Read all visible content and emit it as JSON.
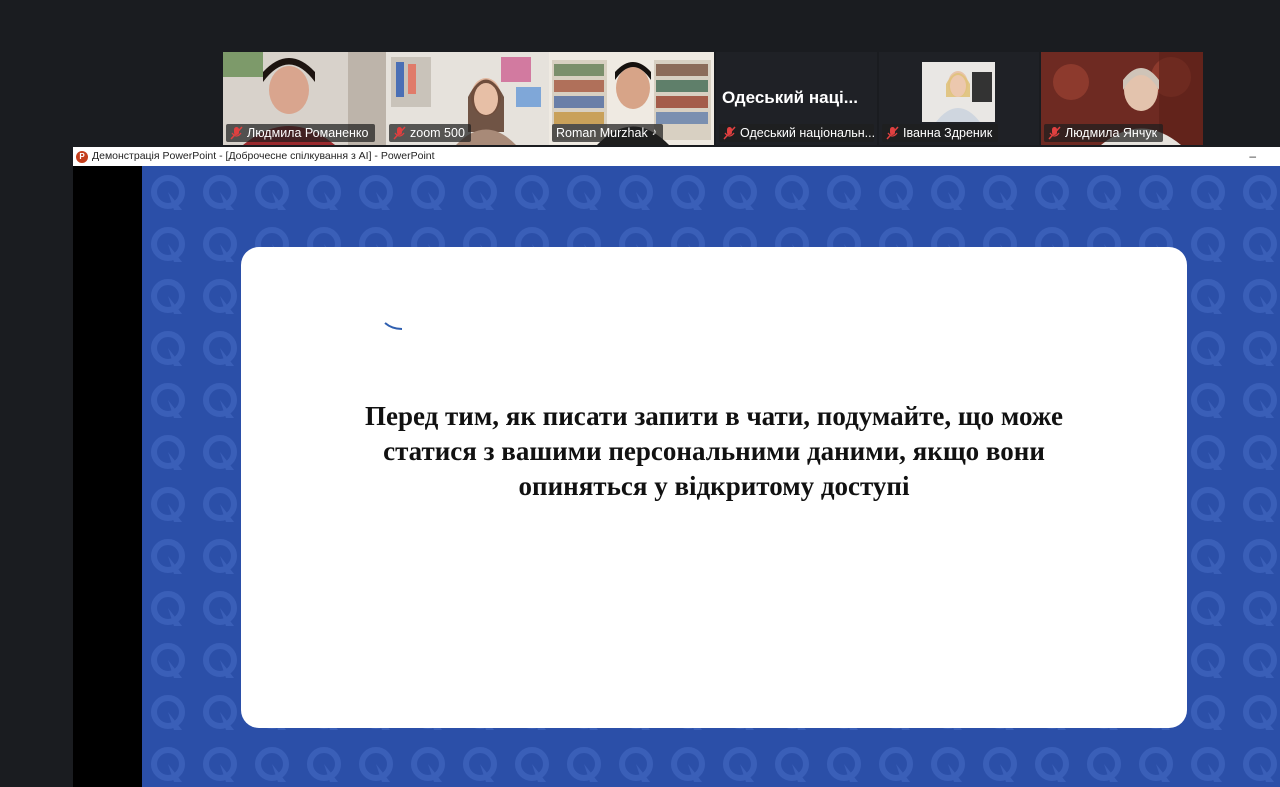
{
  "participants": [
    {
      "name": "Людмила Романенко",
      "muted": true
    },
    {
      "name": "zoom 500",
      "muted": true
    },
    {
      "name": "Roman Murzhak",
      "muted": false,
      "active": true
    },
    {
      "name": "Одеський національн...",
      "muted": true,
      "display_title": "Одеський наці..."
    },
    {
      "name": "Іванна Здреник",
      "muted": true
    },
    {
      "name": "Людмила Янчук",
      "muted": true
    }
  ],
  "window": {
    "app_letter": "P",
    "title": "Демонстрація PowerPoint - [Доброчесне спілкування з AI] - PowerPoint",
    "minimize_glyph": "–"
  },
  "slide": {
    "text_lines": [
      "Перед тим, як писати запити в чати, подумайте, що може",
      "статися з вашими персональними даними, якщо вони",
      "опиняться у відкритому доступі"
    ]
  },
  "colors": {
    "slide_background": "#2b4fa8",
    "active_speaker": "#2ecc71",
    "mic_off": "#e04040"
  }
}
